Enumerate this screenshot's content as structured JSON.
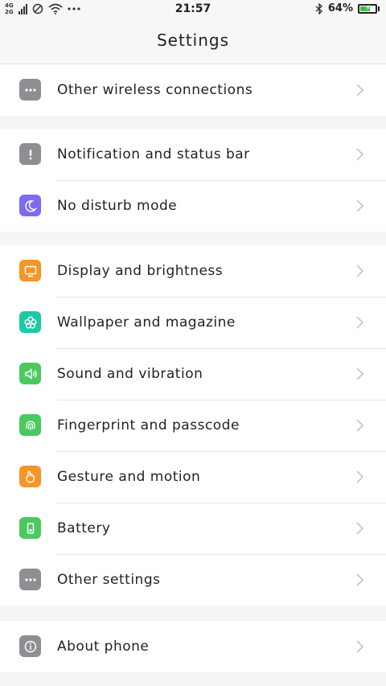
{
  "status_bar": {
    "network_top": "4G",
    "network_bottom": "2G",
    "time": "21:57",
    "battery_percent": "64%",
    "battery_level": 0.64
  },
  "header": {
    "title": "Settings"
  },
  "groups": [
    {
      "items": [
        {
          "label": "Other wireless connections",
          "icon": "more-dots-icon",
          "color": "#8e8e93"
        }
      ]
    },
    {
      "items": [
        {
          "label": "Notification and status bar",
          "icon": "exclamation-icon",
          "color": "#8e8e93"
        },
        {
          "label": "No disturb mode",
          "icon": "moon-icon",
          "color": "#7b6cf2"
        }
      ]
    },
    {
      "items": [
        {
          "label": "Display and brightness",
          "icon": "monitor-icon",
          "color": "#f5952a"
        },
        {
          "label": "Wallpaper and magazine",
          "icon": "flower-icon",
          "color": "#1dc9a4"
        },
        {
          "label": "Sound and vibration",
          "icon": "speaker-icon",
          "color": "#4cc860"
        },
        {
          "label": "Fingerprint and passcode",
          "icon": "fingerprint-icon",
          "color": "#4cc860"
        },
        {
          "label": "Gesture and motion",
          "icon": "hand-icon",
          "color": "#f5952a"
        },
        {
          "label": "Battery",
          "icon": "battery-icon",
          "color": "#4cc860"
        },
        {
          "label": "Other settings",
          "icon": "more-dots-icon",
          "color": "#8e8e93"
        }
      ]
    },
    {
      "items": [
        {
          "label": "About phone",
          "icon": "info-icon",
          "color": "#8e8e93"
        }
      ]
    }
  ]
}
